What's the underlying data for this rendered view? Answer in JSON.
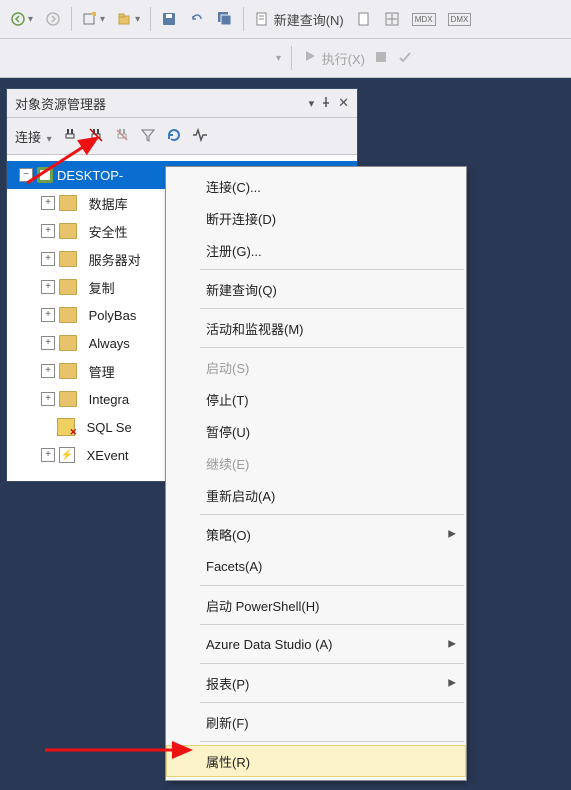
{
  "toolbar": {
    "new_query": "新建查询(N)",
    "execute": "执行(X)"
  },
  "panel": {
    "title": "对象资源管理器",
    "connect_label": "连接"
  },
  "tree": {
    "server": "DESKTOP-",
    "items": [
      {
        "label": "数据库"
      },
      {
        "label": "安全性"
      },
      {
        "label": "服务器对"
      },
      {
        "label": "复制"
      },
      {
        "label": "PolyBas"
      },
      {
        "label": "Always"
      },
      {
        "label": "管理"
      },
      {
        "label": "Integra"
      }
    ],
    "sql_agent": "SQL Se",
    "xevent": "XEvent"
  },
  "contextmenu": {
    "connect": "连接(C)...",
    "disconnect": "断开连接(D)",
    "register": "注册(G)...",
    "new_query": "新建查询(Q)",
    "activity_monitor": "活动和监视器(M)",
    "start": "启动(S)",
    "stop": "停止(T)",
    "pause": "暂停(U)",
    "resume": "继续(E)",
    "restart": "重新启动(A)",
    "policy": "策略(O)",
    "facets": "Facets(A)",
    "powershell": "启动 PowerShell(H)",
    "ads": "Azure Data Studio (A)",
    "reports": "报表(P)",
    "refresh": "刷新(F)",
    "properties": "属性(R)"
  }
}
